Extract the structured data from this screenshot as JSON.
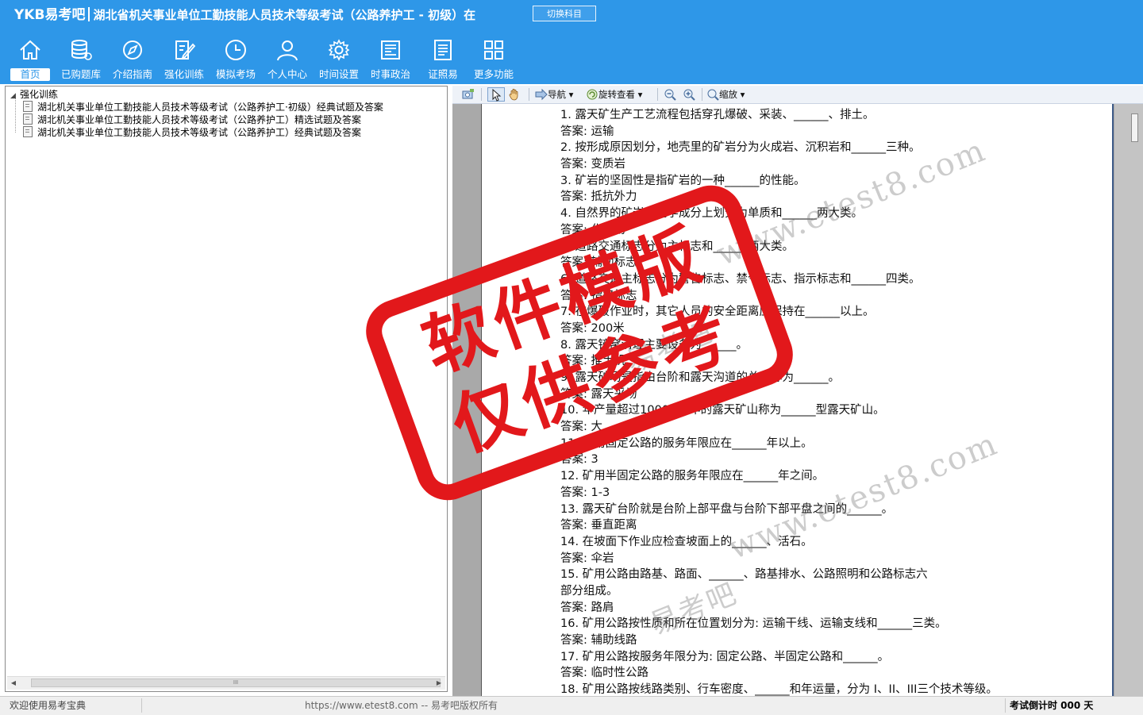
{
  "header": {
    "brand": "YKB易考吧",
    "title": "湖北省机关事业单位工勤技能人员技术等级考试（公路养护工 - 初级）在",
    "switch_label": "切换科目",
    "bg_color": "#2e97e8"
  },
  "nav": [
    {
      "label": "首页",
      "icon": "home-icon",
      "active": true
    },
    {
      "label": "已购题库",
      "icon": "database-icon"
    },
    {
      "label": "介绍指南",
      "icon": "compass-icon"
    },
    {
      "label": "强化训练",
      "icon": "edit-icon"
    },
    {
      "label": "模拟考场",
      "icon": "clock-icon"
    },
    {
      "label": "个人中心",
      "icon": "user-icon"
    },
    {
      "label": "时间设置",
      "icon": "gear-icon"
    },
    {
      "label": "时事政治",
      "icon": "news-icon"
    },
    {
      "label": "证照易",
      "icon": "certificate-icon"
    },
    {
      "label": "更多功能",
      "icon": "grid-icon"
    }
  ],
  "tree": {
    "root": "强化训练",
    "children": [
      "湖北机关事业单位工勤技能人员技术等级考试（公路养护工·初级）经典试题及答案",
      "湖北机关事业单位工勤技能人员技术等级考试（公路养护工）精选试题及答案",
      "湖北机关事业单位工勤技能人员技术等级考试（公路养护工）经典试题及答案"
    ]
  },
  "scrollbar": {
    "thumb_mark": "III"
  },
  "toolbar": {
    "nav_label": "导航",
    "rotate_label": "旋转查看",
    "zoom_label": "缩放"
  },
  "document": {
    "lines": [
      "1. 露天矿生产工艺流程包括穿孔爆破、采装、______、排土。",
      "答案: 运输",
      "2. 按形成原因划分，地壳里的矿岩分为火成岩、沉积岩和______三种。",
      "答案: 变质岩",
      "3. 矿岩的坚固性是指矿岩的一种______的性能。",
      "答案: 抵抗外力",
      "4. 自然界的矿岩从化学成分上划分为单质和______两大类。",
      "答案: 化合物",
      "5. 道路交通标志分为主标志和______两大类。",
      "答案: 辅助标志",
      "6. 道路交通主标志分为警告标志、禁令标志、指示标志和______四类。",
      "答案: 指路标志",
      "7. 在爆破作业时，其它人员的安全距离应保持在______以上。",
      "答案: 200米",
      "8. 露天铲窝清理主要设备为______。",
      "答案: 推土机",
      "9. 露天矿场是指由台阶和露天沟道的总和称为______。",
      "答案: 露天采场",
      "10. 年产量超过1000万t/年的露天矿山称为______型露天矿山。",
      "答案: 大",
      "11. 矿用固定公路的服务年限应在______年以上。",
      "答案: 3",
      "12. 矿用半固定公路的服务年限应在______年之间。",
      "答案: 1-3",
      "13. 露天矿台阶就是台阶上部平盘与台阶下部平盘之间的______。",
      "答案: 垂直距离",
      "14. 在坡面下作业应检查坡面上的______、活石。",
      "答案: 伞岩",
      "15. 矿用公路由路基、路面、______、路基排水、公路照明和公路标志六",
      "部分组成。",
      "答案: 路肩",
      "16. 矿用公路按性质和所在位置划分为: 运输干线、运输支线和______三类。",
      "答案: 辅助线路",
      "17. 矿用公路按服务年限分为: 固定公路、半固定公路和______。",
      "答案: 临时性公路",
      "18. 矿用公路按线路类别、行车密度、______和年运量，分为 I、II、III三个技术等级。"
    ]
  },
  "stamp": {
    "line1": "软件模版",
    "line2": "仅供参考",
    "color": "#e2181b"
  },
  "watermark": {
    "domain": "www.etest8.com",
    "brand": "易考吧"
  },
  "status": {
    "welcome": "欢迎使用易考宝典",
    "copyright": "https://www.etest8.com -- 易考吧版权所有",
    "countdown": "考试倒计时 000 天"
  }
}
